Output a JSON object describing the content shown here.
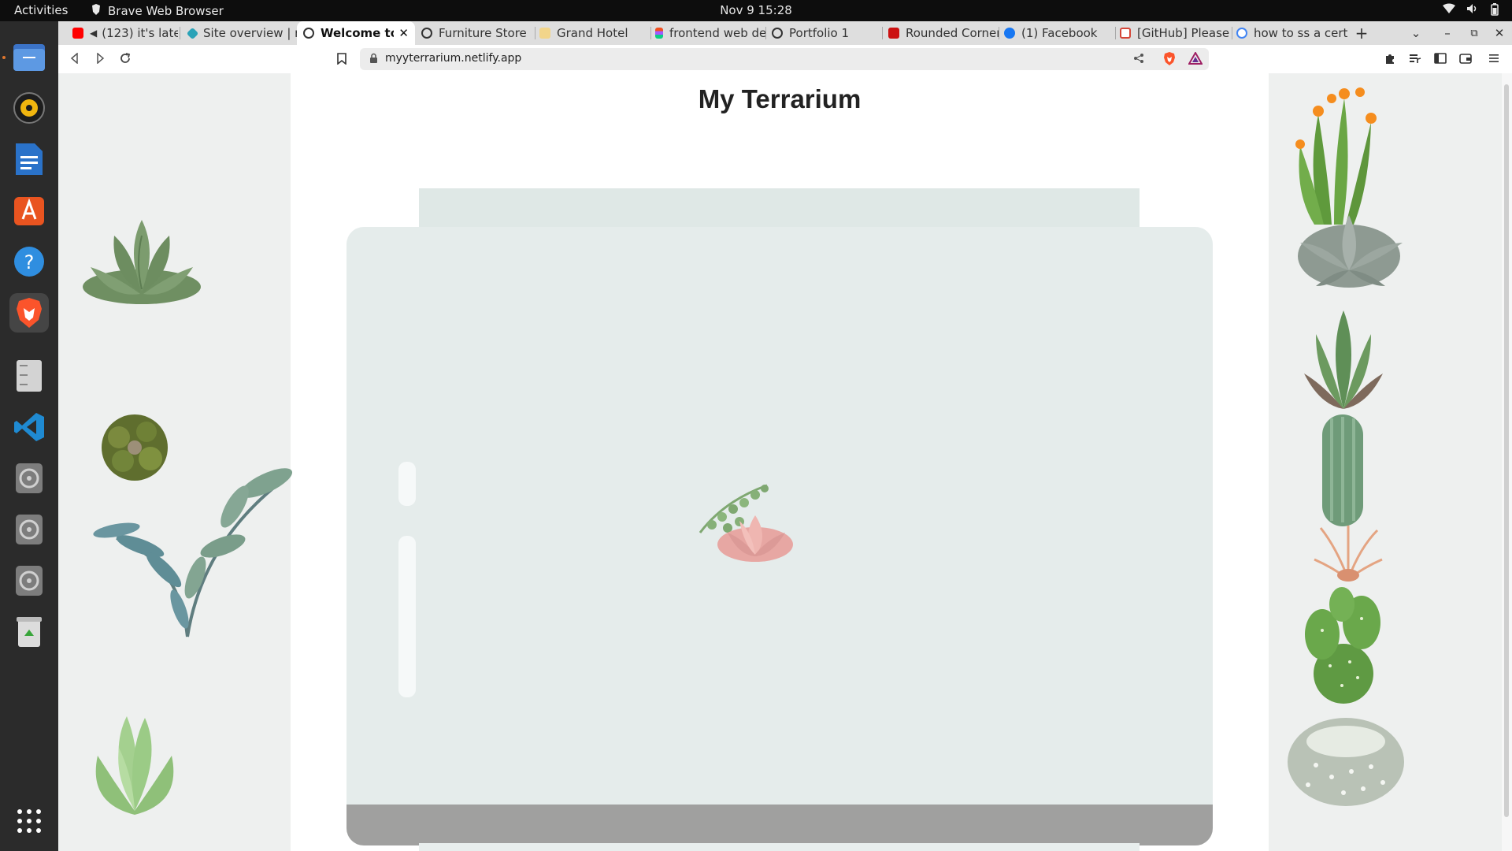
{
  "system": {
    "activities_label": "Activities",
    "app_name": "Brave Web Browser",
    "clock": "Nov 9  15:28"
  },
  "dock": {
    "items": [
      "files",
      "rhythmbox",
      "writer",
      "app-center",
      "help",
      "brave",
      "storage",
      "vscode",
      "disc-1",
      "disc-2",
      "disc-3",
      "trash",
      "show-apps"
    ]
  },
  "tabs": [
    {
      "title": "(123) it's late",
      "favicon_color": "#ff0000"
    },
    {
      "title": "Site overview | n",
      "favicon_color": "#2aa3b8"
    },
    {
      "title": "Welcome to m",
      "favicon_color": "#333333"
    },
    {
      "title": "Furniture Store",
      "favicon_color": "#333333"
    },
    {
      "title": "Grand Hotel",
      "favicon_color": "#e0b040"
    },
    {
      "title": "frontend web de",
      "favicon_color": "#e8543a"
    },
    {
      "title": "Portfolio 1",
      "favicon_color": "#333333"
    },
    {
      "title": "Rounded Corner",
      "favicon_color": "#cc1111"
    },
    {
      "title": "(1) Facebook",
      "favicon_color": "#1877f2"
    },
    {
      "title": "[GitHub] Please",
      "favicon_color": "#d44638"
    },
    {
      "title": "how to ss a cert",
      "favicon_color": "#4285f4"
    }
  ],
  "toolbar": {
    "url": "myyterrarium.netlify.app",
    "new_tab_label": "+"
  },
  "page": {
    "title": "My Terrarium"
  },
  "colors": {
    "side_column_bg": "#eef0ef",
    "jar_glass": "#e5eceb",
    "jar_top": "#dfe8e6",
    "jar_bottom": "#a0a09f"
  }
}
